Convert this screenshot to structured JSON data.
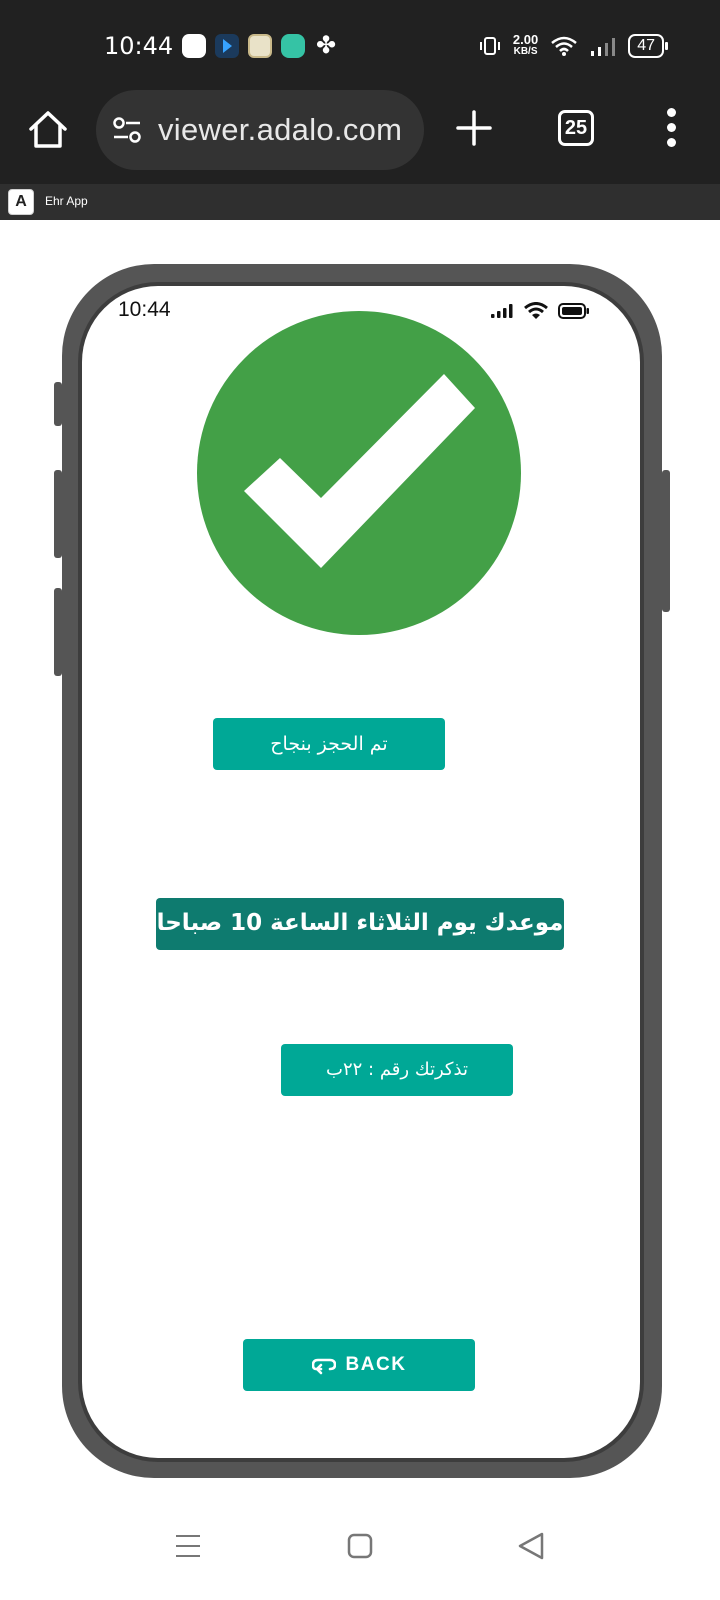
{
  "system_status": {
    "time": "10:44",
    "net_speed_value": "2.00",
    "net_speed_unit": "KB/S",
    "battery": "47",
    "notification_icons": [
      "app-notification-icon",
      "flow-app-icon",
      "badge-app-icon",
      "chat-app-icon",
      "pinwheel-icon"
    ],
    "right_icons": [
      "vibrate-icon",
      "wifi-icon",
      "signal-icon",
      "battery-icon"
    ]
  },
  "browser": {
    "url": "viewer.adalo.com",
    "tab_count": "25",
    "icons": [
      "home-icon",
      "site-settings-icon",
      "new-tab-icon",
      "tab-switcher-icon",
      "more-menu-icon"
    ]
  },
  "app_header": {
    "logo_letter": "A",
    "title": "Ehr App"
  },
  "phone": {
    "time": "10:44",
    "status_icons": [
      "signal-icon",
      "wifi-icon",
      "battery-icon"
    ],
    "success_icon": "check-circle-icon",
    "colors": {
      "success_green": "#43a047",
      "teal": "#00a896",
      "dark_teal": "#0e7b6f"
    },
    "booking_success": "تم الحجز بنجاح",
    "appointment": "موعدك يوم الثلاثاء الساعة 10 صباحا",
    "ticket": "تذكرتك رقم : ٢٢ب",
    "back_label": "BACK",
    "back_icon": "undo-icon"
  },
  "nav_bar": {
    "buttons": [
      "recents-icon",
      "home-icon",
      "back-icon"
    ]
  }
}
